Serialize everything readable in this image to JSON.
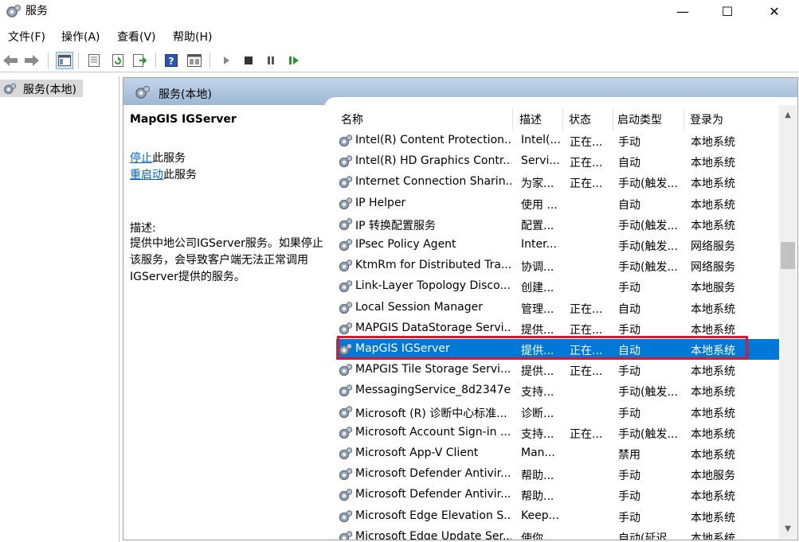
{
  "window": {
    "title": "服务",
    "minimize": "—",
    "maximize": "☐",
    "close": "✕"
  },
  "menu": [
    "文件(F)",
    "操作(A)",
    "查看(V)",
    "帮助(H)"
  ],
  "toolbar": {
    "buttons": [
      "back-arrow-icon",
      "forward-arrow-icon",
      "console-tree-icon",
      "properties-icon",
      "refresh-icon",
      "export-list-icon",
      "help-icon",
      "view-icon",
      "start-service-icon",
      "stop-service-icon",
      "pause-service-icon",
      "resume-service-icon"
    ]
  },
  "tree": {
    "root": "服务(本地)"
  },
  "panel": {
    "header": "服务(本地)"
  },
  "details": {
    "service_name": "MapGIS IGServer",
    "stop_link": "停止",
    "stop_suffix": "此服务",
    "restart_link": "重启动",
    "restart_suffix": "此服务",
    "desc_label": "描述:",
    "desc_text": "提供中地公司IGServer服务。如果停止该服务，会导致客户端无法正常调用IGServer提供的服务。"
  },
  "columns": {
    "name": "名称",
    "desc": "描述",
    "status": "状态",
    "start": "启动类型",
    "logon": "登录为"
  },
  "rows": [
    {
      "name": "Intel(R) Content Protection...",
      "desc": "Intel(...",
      "status": "正在...",
      "start": "手动",
      "logon": "本地系统"
    },
    {
      "name": "Intel(R) HD Graphics Contr...",
      "desc": "Servi...",
      "status": "正在...",
      "start": "自动",
      "logon": "本地系统"
    },
    {
      "name": "Internet Connection Sharin...",
      "desc": "为家...",
      "status": "正在...",
      "start": "手动(触发...",
      "logon": "本地系统"
    },
    {
      "name": "IP Helper",
      "desc": "使用 ...",
      "status": "",
      "start": "自动",
      "logon": "本地系统"
    },
    {
      "name": "IP 转换配置服务",
      "desc": "配置...",
      "status": "",
      "start": "手动(触发...",
      "logon": "本地系统"
    },
    {
      "name": "IPsec Policy Agent",
      "desc": "Inter...",
      "status": "",
      "start": "手动(触发...",
      "logon": "网络服务"
    },
    {
      "name": "KtmRm for Distributed Tra...",
      "desc": "协调...",
      "status": "",
      "start": "手动(触发...",
      "logon": "网络服务"
    },
    {
      "name": "Link-Layer Topology Disco...",
      "desc": "创建...",
      "status": "",
      "start": "手动",
      "logon": "本地服务"
    },
    {
      "name": "Local Session Manager",
      "desc": "管理...",
      "status": "正在...",
      "start": "自动",
      "logon": "本地系统"
    },
    {
      "name": "MAPGIS DataStorage Servi...",
      "desc": "提供...",
      "status": "正在...",
      "start": "手动",
      "logon": "本地系统"
    },
    {
      "name": "MapGIS IGServer",
      "desc": "提供...",
      "status": "正在...",
      "start": "自动",
      "logon": "本地系统",
      "selected": true
    },
    {
      "name": "MAPGIS Tile Storage Servi...",
      "desc": "提供...",
      "status": "正在...",
      "start": "手动",
      "logon": "本地系统"
    },
    {
      "name": "MessagingService_8d2347e",
      "desc": "支持...",
      "status": "",
      "start": "手动(触发...",
      "logon": "本地系统"
    },
    {
      "name": "Microsoft (R) 诊断中心标准...",
      "desc": "诊断...",
      "status": "",
      "start": "手动",
      "logon": "本地系统"
    },
    {
      "name": "Microsoft Account Sign-in ...",
      "desc": "支持...",
      "status": "正在...",
      "start": "手动(触发...",
      "logon": "本地系统"
    },
    {
      "name": "Microsoft App-V Client",
      "desc": "Man...",
      "status": "",
      "start": "禁用",
      "logon": "本地系统"
    },
    {
      "name": "Microsoft Defender Antivir...",
      "desc": "帮助...",
      "status": "",
      "start": "手动",
      "logon": "本地服务"
    },
    {
      "name": "Microsoft Defender Antivir...",
      "desc": "帮助...",
      "status": "",
      "start": "手动",
      "logon": "本地系统"
    },
    {
      "name": "Microsoft Edge Elevation S...",
      "desc": "Keep...",
      "status": "",
      "start": "手动",
      "logon": "本地系统"
    },
    {
      "name": "Microsoft Edge Update Ser...",
      "desc": "使你...",
      "status": "",
      "start": "自动(延迟...",
      "logon": "本地系统"
    }
  ],
  "colors": {
    "selected_row": "#0078d7",
    "link": "#0066cc",
    "highlight_box": "#e0162b"
  }
}
